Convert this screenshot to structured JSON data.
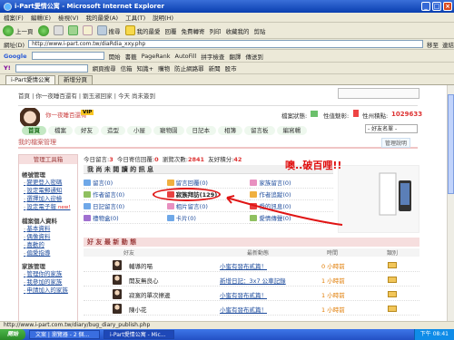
{
  "window": {
    "title": "i-Part愛情公寓 - Microsoft Internet Explorer"
  },
  "menubar": {
    "items": [
      "檔案(F)",
      "編輯(E)",
      "檢視(V)",
      "我的最愛(A)",
      "工具(T)",
      "說明(H)"
    ]
  },
  "toolbar": {
    "back": "上一頁",
    "search": "搜尋",
    "favorites": "我的最愛",
    "items": [
      "回覆",
      "免費轉寄",
      "列印",
      "收藏我的",
      "剪貼"
    ]
  },
  "addressbar": {
    "label": "網址(D)",
    "url": "http://www.i-part.com.tw/diaRdia_xxy.php",
    "go": "移至",
    "links": "連結"
  },
  "google_bar": {
    "label": "Google",
    "go": "開始",
    "items": [
      "書籤",
      "PageRank",
      "AutoFill",
      "拼字檢查",
      "翻譯",
      "傳送到"
    ]
  },
  "yahoo_bar": {
    "label": "Y!",
    "search_label": "網頁搜尋",
    "items": [
      "信箱",
      "知識+",
      "購物",
      "防止網路罪",
      "新聞",
      "股市"
    ]
  },
  "tabs": [
    {
      "label": "i-Part愛情公寓"
    },
    {
      "label": "新增分頁"
    }
  ],
  "site": {
    "top_links": "首頁 | 你一夜睡百還有 | 劉玉淑回家 | 今天 尚未簽到",
    "search_placeholder": "",
    "username": "你一夜睡百還有",
    "vip": "VIP",
    "stats": {
      "status_label": "檔案狀態:",
      "popularity_label": "性值魅彰:",
      "score_label": "性州積點:",
      "score": "1029633"
    },
    "nav": [
      "首頁",
      "檔案",
      "好友",
      "造型",
      "小屋",
      "寵物園",
      "日記本",
      "相簿",
      "留言板",
      "編寫輯"
    ],
    "dropdown": "- 好友名單 -",
    "manager_title": "我的檔案管理",
    "help": "管理說明"
  },
  "sidebar": {
    "title": "管理工具箱",
    "sections": [
      {
        "title": "帳號管理",
        "items": [
          "變更登入密碼",
          "設定電郵通知",
          "選擇加入迎檢",
          "設定電子報"
        ]
      },
      {
        "title": "檔案個人資料",
        "items": [
          "基本資料",
          "偶像資料",
          "喜歡的",
          "偏愛指導"
        ]
      },
      {
        "title": "家族管理",
        "items": [
          "管理你的家族",
          "我參加的家族",
          "申請加入的家族"
        ]
      }
    ],
    "new_badge": "new!"
  },
  "main": {
    "counts": {
      "today_label": "今日留言:",
      "today": "3",
      "today_sent_label": "今日寄信回覆:",
      "today_sent": "0",
      "views_label": "瀏覽次數:",
      "views": "2841",
      "gifts_label": "友好積分:",
      "gifts": "42"
    },
    "notif_title": "我 尚 未 閱 讀 的 訊 息",
    "notifs": [
      {
        "label": "留言(0)",
        "color": "#6fa8e8",
        "hl": false
      },
      {
        "label": "留言回覆(0)",
        "color": "#f0b040",
        "hl": false
      },
      {
        "label": "家族留言(0)",
        "color": "#e890c0",
        "hl": false
      },
      {
        "label": "作者留言(0)",
        "color": "#8fc060",
        "hl": false
      },
      {
        "label": "寂族拜訪(129)",
        "color": "#e84040",
        "hl": true
      },
      {
        "label": "作者追蹤(0)",
        "color": "#f0b040",
        "hl": false
      },
      {
        "label": "日記留言(0)",
        "color": "#6fa8e8",
        "hl": false
      },
      {
        "label": "相片留言(0)",
        "color": "#e890c0",
        "hl": false
      },
      {
        "label": "愛的訊息(0)",
        "color": "#e84040",
        "hl": false
      },
      {
        "label": "禮物盒(0)",
        "color": "#a070d0",
        "hl": false
      },
      {
        "label": "卡片(0)",
        "color": "#6fa8e8",
        "hl": false
      },
      {
        "label": "愛情傳聲(0)",
        "color": "#8fc060",
        "hl": false
      }
    ],
    "annotation": "噢..破百哩!!",
    "friends_title": "好 友 最 新 動 態",
    "col_headers": [
      "好友",
      "最新動態",
      "時間",
      "類別"
    ],
    "friends": [
      {
        "name": "輔導的喵",
        "action": "小蜜有發布貳篇！",
        "time": "0 小時前"
      },
      {
        "name": "開友無良心",
        "action": "新增日記：3x7 公車記錄",
        "time": "1 小時前"
      },
      {
        "name": "寂寞的單次擦邊",
        "action": "小蜜有發布貳篇！",
        "time": "1 小時前"
      },
      {
        "name": "陳小花",
        "action": "小蜜有發布貳篇！",
        "time": "1 小時前"
      }
    ]
  },
  "statusbar": {
    "text": "http://www.i-part.com.tw/diary/bug_diary_publish.php"
  },
  "taskbar": {
    "start": "開始",
    "tasks": [
      "文案 | 瀏覽器 - 2 個...",
      "i-Part愛情公寓 - Mic..."
    ],
    "clock": "下午 08:41"
  }
}
